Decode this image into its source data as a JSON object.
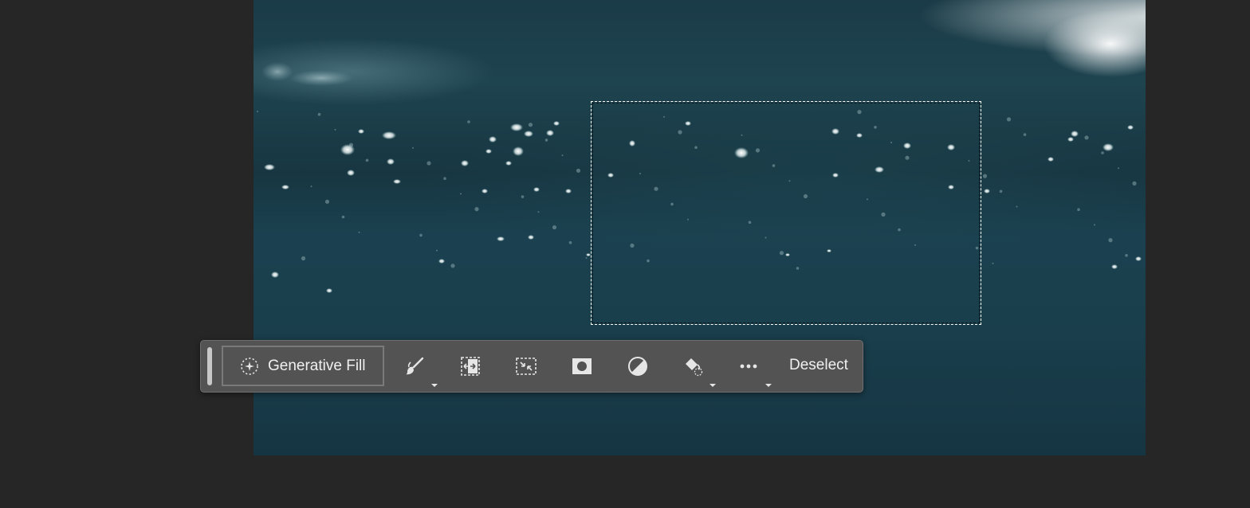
{
  "canvas": {
    "image_description_icon": "water-bokeh-image"
  },
  "contextual_taskbar": {
    "generative_fill_label": "Generative Fill",
    "deselect_label": "Deselect",
    "tools": [
      {
        "icon": "brush-icon",
        "has_dropdown": true
      },
      {
        "icon": "transform-selection-icon",
        "has_dropdown": false
      },
      {
        "icon": "invert-selection-icon",
        "has_dropdown": false
      },
      {
        "icon": "mask-icon",
        "has_dropdown": false
      },
      {
        "icon": "adjustment-icon",
        "has_dropdown": false
      },
      {
        "icon": "fill-bucket-icon",
        "has_dropdown": true
      },
      {
        "icon": "more-options-icon",
        "has_dropdown": true
      }
    ]
  },
  "colors": {
    "workspace_bg": "#262626",
    "taskbar_bg": "#535353",
    "icon_color": "#e6e6e6"
  }
}
